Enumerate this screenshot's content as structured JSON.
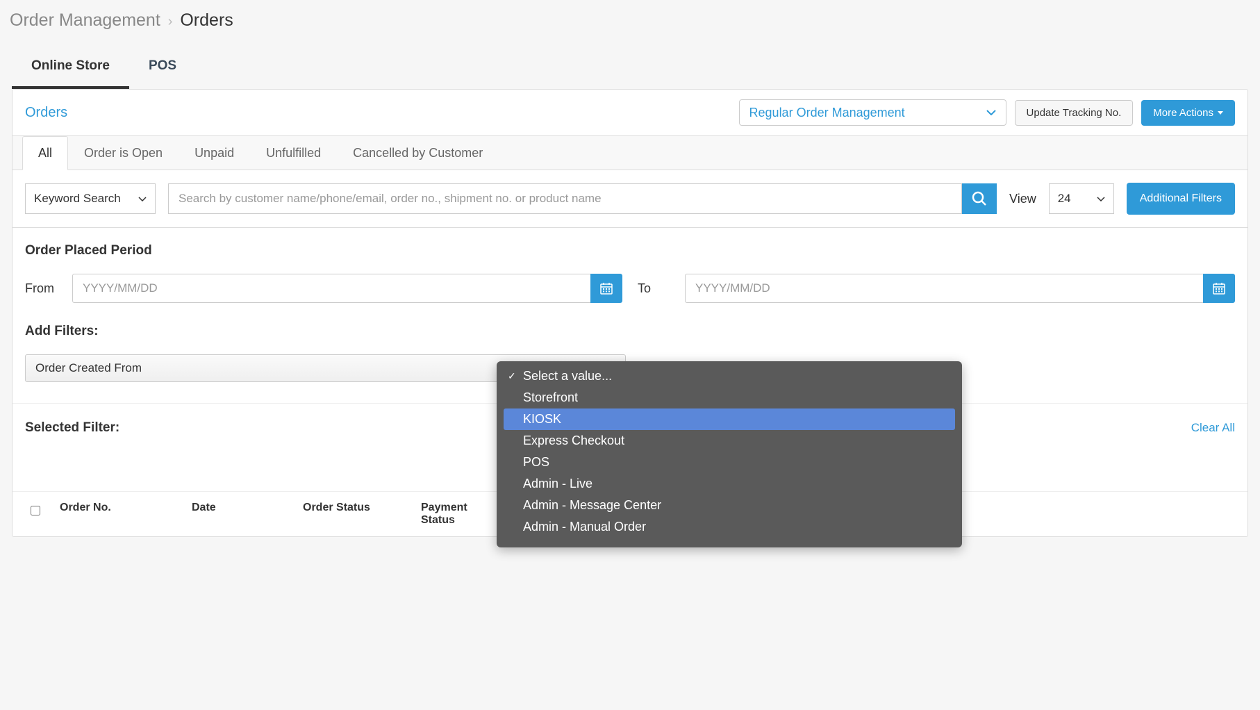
{
  "breadcrumb": {
    "parent": "Order Management",
    "current": "Orders"
  },
  "mainTabs": [
    {
      "label": "Online Store",
      "active": true
    },
    {
      "label": "POS",
      "active": false
    }
  ],
  "panel": {
    "title": "Orders",
    "orderTypeSelect": "Regular Order Management",
    "updateTrackingBtn": "Update Tracking No.",
    "moreActionsBtn": "More Actions"
  },
  "subTabs": [
    {
      "label": "All",
      "active": true
    },
    {
      "label": "Order is Open",
      "active": false
    },
    {
      "label": "Unpaid",
      "active": false
    },
    {
      "label": "Unfulfilled",
      "active": false
    },
    {
      "label": "Cancelled by Customer",
      "active": false
    }
  ],
  "search": {
    "keywordSelect": "Keyword Search",
    "placeholder": "Search by customer name/phone/email, order no., shipment no. or product name",
    "viewLabel": "View",
    "viewValue": "24",
    "addFiltersBtn": "Additional Filters"
  },
  "filters": {
    "periodTitle": "Order Placed Period",
    "fromLabel": "From",
    "toLabel": "To",
    "datePlaceholder": "YYYY/MM/DD",
    "addFiltersLabel": "Add Filters:",
    "filterSelect1": "Order Created From",
    "dropdownOptions": [
      {
        "label": "Select a value...",
        "selected": true,
        "highlighted": false
      },
      {
        "label": "Storefront",
        "selected": false,
        "highlighted": false
      },
      {
        "label": "KIOSK",
        "selected": false,
        "highlighted": true
      },
      {
        "label": "Express Checkout",
        "selected": false,
        "highlighted": false
      },
      {
        "label": "POS",
        "selected": false,
        "highlighted": false
      },
      {
        "label": "Admin - Live",
        "selected": false,
        "highlighted": false
      },
      {
        "label": "Admin - Message Center",
        "selected": false,
        "highlighted": false
      },
      {
        "label": "Admin - Manual Order",
        "selected": false,
        "highlighted": false
      }
    ]
  },
  "selectedFilter": {
    "label": "Selected Filter:",
    "clearAll": "Clear All"
  },
  "tableHeaders": {
    "orderNo": "Order No.",
    "date": "Date",
    "orderStatus": "Order Status",
    "paymentStatus": "Payment Status"
  }
}
